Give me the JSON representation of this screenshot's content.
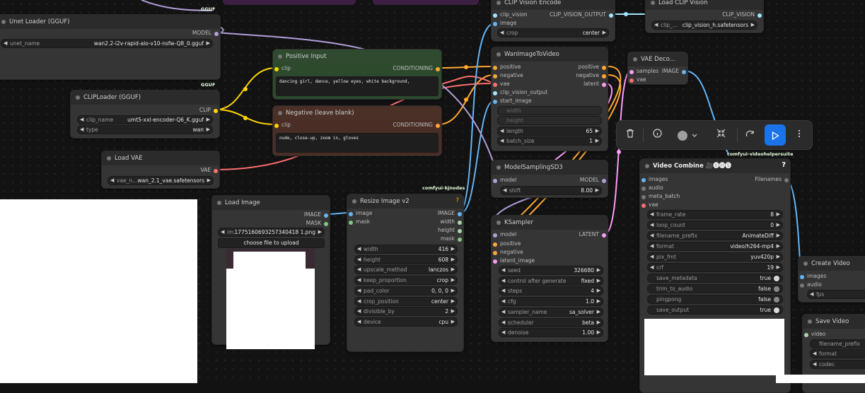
{
  "badges": {
    "gguf1": "GGUF",
    "gguf2": "GGUF",
    "kjnodes": "comfyui-kjnodes",
    "vhs": "comfyui-videohelpersuite"
  },
  "unet_loader": {
    "title": "Unet Loader (GGUF)",
    "out_model": "MODEL",
    "w_unet_label": "unet_name",
    "w_unet_value": "wan2.2-i2v-rapid-aio-v10-nsfw-Q8_0.gguf"
  },
  "clip_loader": {
    "title": "CLIPLoader (GGUF)",
    "out_clip": "CLIP",
    "w_clip_label": "clip_name",
    "w_clip_value": "umt5-xxl-encoder-Q6_K.gguf",
    "w_type_label": "type",
    "w_type_value": "wan"
  },
  "load_vae": {
    "title": "Load VAE",
    "out_vae": "VAE",
    "w_label": "vae_n...",
    "w_value": "wan_2.1_vae.safetensors"
  },
  "positive": {
    "title": "Positive Input",
    "in_clip": "clip",
    "out": "CONDITIONING",
    "text": "dancing girl, dance, yellow eyes, white background,"
  },
  "negative": {
    "title": "Negative (leave blank)",
    "in_clip": "clip",
    "out": "CONDITIONING",
    "text": "nude, close-up, zoom in, gloves"
  },
  "load_image": {
    "title": "Load Image",
    "out_image": "IMAGE",
    "out_mask": "MASK",
    "w_label": "im...",
    "w_value": "1775160693257340418 1.png",
    "upload": "choose file to upload"
  },
  "resize": {
    "title": "Resize Image v2",
    "q": "?",
    "in_image": "image",
    "in_mask": "mask",
    "out_image": "IMAGE",
    "out_width": "width",
    "out_height": "height",
    "out_mask": "mask",
    "widgets": [
      [
        "width",
        "416"
      ],
      [
        "height",
        "608"
      ],
      [
        "upscale_method",
        "lanczos"
      ],
      [
        "keep_proportion",
        "crop"
      ],
      [
        "pad_color",
        "0, 0, 0"
      ],
      [
        "crop_position",
        "center"
      ],
      [
        "divisible_by",
        "2"
      ],
      [
        "device",
        "cpu"
      ]
    ]
  },
  "clip_vision_encode": {
    "title": "CLIP Vision Encode",
    "in_cv": "clip_vision",
    "in_image": "image",
    "out": "CLIP_VISION_OUTPUT",
    "w_crop_label": "crop",
    "w_crop_value": "center"
  },
  "load_clip_vision": {
    "title": "Load CLIP Vision",
    "out": "CLIP_VISION",
    "w_label": "clip_...",
    "w_value": "clip_vision_h.safetensors"
  },
  "wan_i2v": {
    "title": "WanImageToVideo",
    "in_positive": "positive",
    "in_negative": "negative",
    "in_vae": "vae",
    "in_cvo": "clip_vision_output",
    "in_start": "start_image",
    "in_width": "width",
    "in_height": "height",
    "out_positive": "positive",
    "out_negative": "negative",
    "out_latent": "latent",
    "w_length_label": "length",
    "w_length_value": "65",
    "w_batch_label": "batch_size",
    "w_batch_value": "1"
  },
  "vae_decode": {
    "title": "VAE Deco...",
    "in_samples": "samples",
    "in_vae": "vae",
    "out": "IMAGE"
  },
  "model_sampling": {
    "title": "ModelSamplingSD3",
    "in_model": "model",
    "out": "MODEL",
    "w_label": "shift",
    "w_value": "8.00"
  },
  "ksampler": {
    "title": "KSampler",
    "in_model": "model",
    "in_positive": "positive",
    "in_negative": "negative",
    "in_latent": "latent_image",
    "out": "LATENT",
    "widgets": [
      [
        "seed",
        "326680"
      ],
      [
        "control after generate",
        "fixed"
      ],
      [
        "steps",
        "4"
      ],
      [
        "cfg",
        "1.0"
      ],
      [
        "sampler_name",
        "sa_solver"
      ],
      [
        "scheduler",
        "beta"
      ],
      [
        "denoise",
        "1.00"
      ]
    ]
  },
  "video_combine": {
    "title": "Video Combine",
    "title_icons": "🎥🅥🅗🅢",
    "q": "?",
    "in_images": "images",
    "in_audio": "audio",
    "in_meta": "meta_batch",
    "in_vae": "vae",
    "out": "Filenames",
    "widgets": [
      [
        "frame_rate",
        "8"
      ],
      [
        "loop_count",
        "0"
      ],
      [
        "filename_prefix",
        "AnimateDiff"
      ],
      [
        "format",
        "video/h264-mp4"
      ],
      [
        "pix_fmt",
        "yuv420p"
      ],
      [
        "crf",
        "19"
      ]
    ],
    "toggles": [
      [
        "save_metadata",
        "true",
        true
      ],
      [
        "trim_to_audio",
        "false",
        false
      ],
      [
        "pingpong",
        "false",
        false
      ],
      [
        "save_output",
        "true",
        true
      ]
    ]
  },
  "create_video": {
    "title": "Create Video",
    "in_images": "images",
    "in_audio": "audio",
    "w_label": "fps"
  },
  "save_video": {
    "title": "Save Video",
    "in_video": "video",
    "w_prefix": "filename_prefix",
    "w_format": "format",
    "w_codec": "codec"
  },
  "colors": {
    "clip": "#ffd500",
    "conditioning": "#ffa931",
    "model": "#b39ddb",
    "vae": "#ff6e6e",
    "image": "#64b5f6",
    "latent": "#ff9cf9",
    "clip_vision": "#a1e8ff",
    "mask": "#81c784",
    "int": "#a5d6a7"
  }
}
